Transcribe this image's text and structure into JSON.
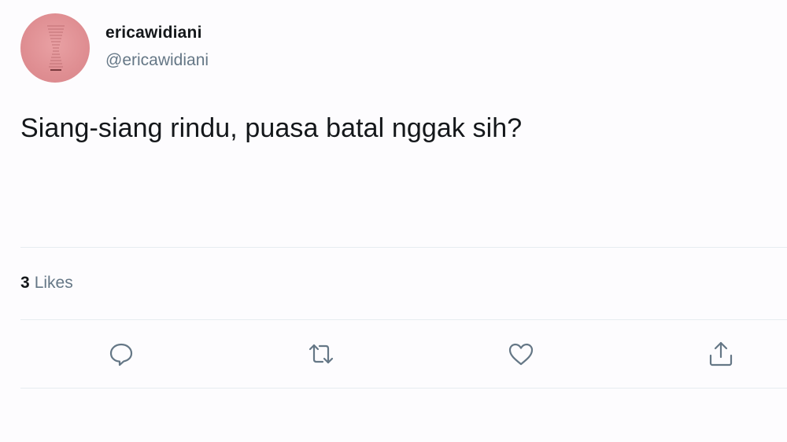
{
  "user": {
    "display_name": "ericawidiani",
    "handle": "@ericawidiani",
    "avatar_color": "#df8e92"
  },
  "tweet": {
    "text": "Siang-siang rindu, puasa batal nggak sih?"
  },
  "stats": {
    "likes_count": "3",
    "likes_label": "Likes"
  },
  "actions": {
    "reply_icon": "reply-icon",
    "retweet_icon": "retweet-icon",
    "like_icon": "heart-icon",
    "share_icon": "share-icon",
    "icon_color": "#657786"
  }
}
